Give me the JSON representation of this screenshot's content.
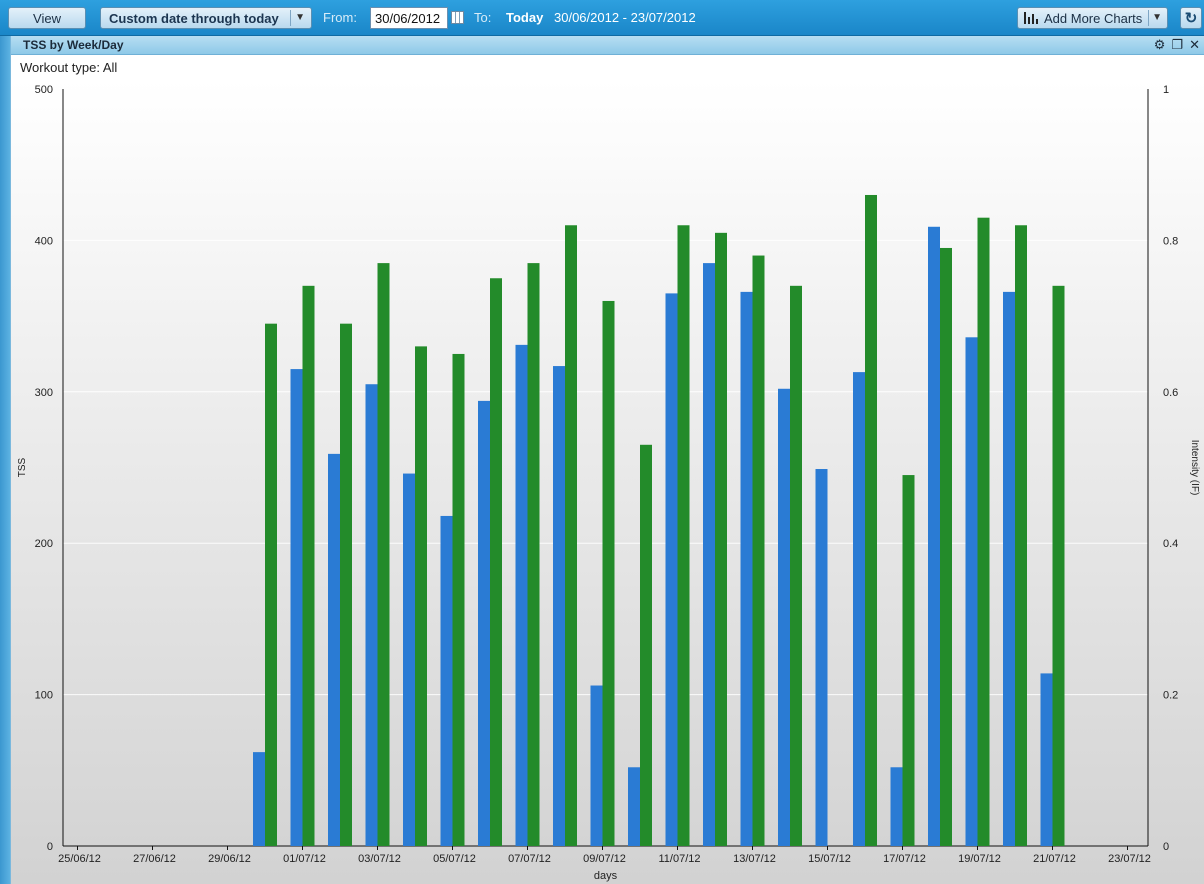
{
  "toolbar": {
    "view_label": "View",
    "range_label": "Custom date through today",
    "from_label": "From:",
    "from_value": "30/06/2012",
    "to_label": "To:",
    "to_value": "Today",
    "range_text": "30/06/2012 - 23/07/2012",
    "add_charts_label": "Add More Charts",
    "refresh_icon": "refresh-icon"
  },
  "panel": {
    "title": "TSS by Week/Day",
    "workout_type": "Workout type: All",
    "icons": [
      "gear-icon",
      "restore-icon",
      "close-icon"
    ]
  },
  "colors": {
    "tss": "#2a7bd4",
    "if": "#238b2a",
    "toolbar": "#1f93d6"
  },
  "chart_data": {
    "type": "bar",
    "xlabel": "days",
    "ylabel": "TSS",
    "ylabel_right": "Intensity (IF)",
    "ylim": [
      0,
      500
    ],
    "ylim_right": [
      0,
      1
    ],
    "yticks": [
      "0",
      "100",
      "200",
      "300",
      "400",
      "500"
    ],
    "yticks_right": [
      "0",
      "0.2",
      "0.4",
      "0.6",
      "0.8",
      "1"
    ],
    "xtick_labels": [
      "25/06/12",
      "27/06/12",
      "29/06/12",
      "01/07/12",
      "03/07/12",
      "05/07/12",
      "07/07/12",
      "09/07/12",
      "11/07/12",
      "13/07/12",
      "15/07/12",
      "17/07/12",
      "19/07/12",
      "21/07/12",
      "23/07/12"
    ],
    "categories": [
      "25/06/12",
      "26/06/12",
      "27/06/12",
      "28/06/12",
      "29/06/12",
      "30/06/12",
      "01/07/12",
      "02/07/12",
      "03/07/12",
      "04/07/12",
      "05/07/12",
      "06/07/12",
      "07/07/12",
      "08/07/12",
      "09/07/12",
      "10/07/12",
      "11/07/12",
      "12/07/12",
      "13/07/12",
      "14/07/12",
      "15/07/12",
      "16/07/12",
      "17/07/12",
      "18/07/12",
      "19/07/12",
      "20/07/12",
      "21/07/12",
      "22/07/12",
      "23/07/12"
    ],
    "series": [
      {
        "axis": "left",
        "values": [
          0,
          0,
          0,
          0,
          0,
          62,
          315,
          259,
          305,
          246,
          218,
          294,
          331,
          317,
          106,
          52,
          365,
          385,
          366,
          302,
          249,
          313,
          52,
          409,
          336,
          366,
          114,
          0,
          0
        ]
      },
      {
        "axis": "right",
        "values": [
          0,
          0,
          0,
          0,
          0,
          0.69,
          0.74,
          0.69,
          0.77,
          0.66,
          0.65,
          0.75,
          0.77,
          0.82,
          0.72,
          0.53,
          0.82,
          0.81,
          0.78,
          0.74,
          0,
          0.86,
          0.49,
          0.79,
          0.83,
          0.82,
          0.74,
          0,
          0
        ]
      }
    ],
    "grid": true
  }
}
